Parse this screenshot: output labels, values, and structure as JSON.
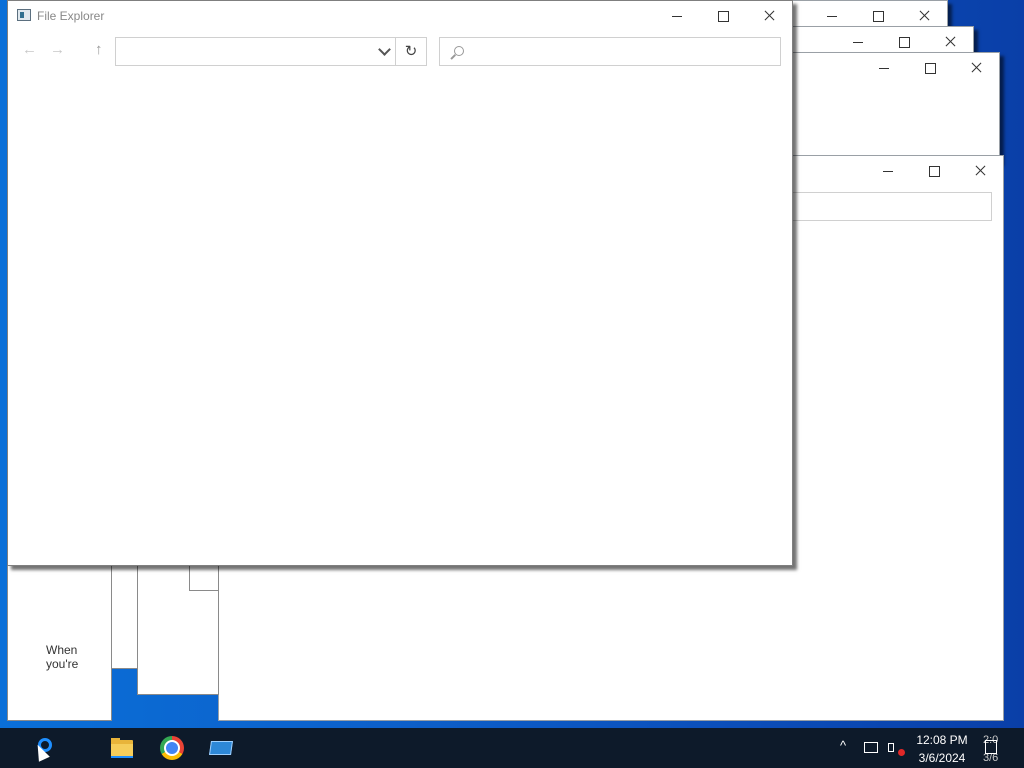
{
  "explorer": {
    "title": "File Explorer",
    "nav_back": "←",
    "nav_forward": "→",
    "nav_up": "↑",
    "refresh_glyph": "↻"
  },
  "background_window": {
    "partial_text": "When you're"
  },
  "taskbar": {
    "time": "12:08 PM",
    "date": "3/6/2024",
    "second_clock_time": "2:0",
    "second_clock_date": "3/6",
    "tray_chevron": "^"
  }
}
